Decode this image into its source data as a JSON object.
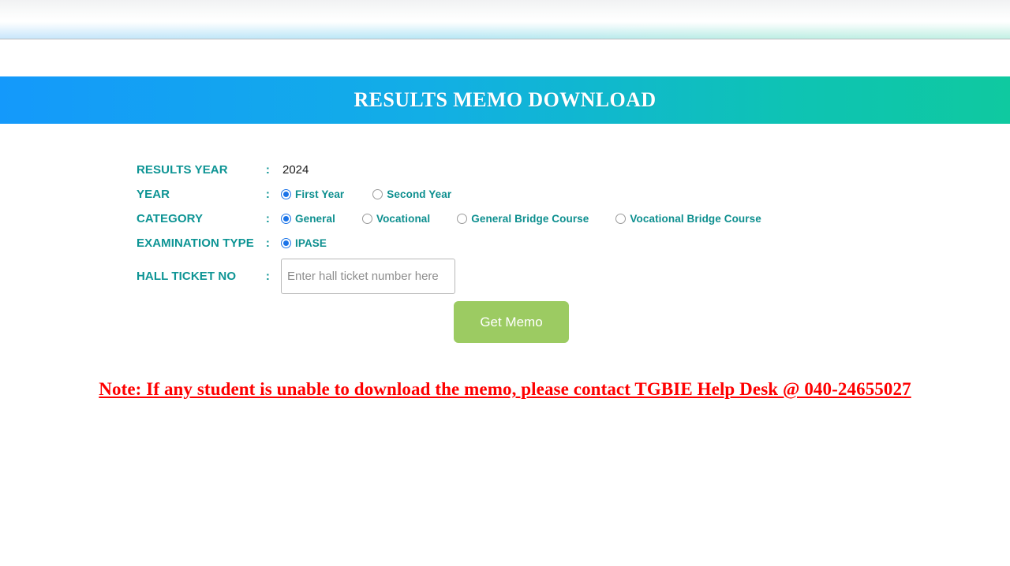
{
  "header": {
    "title": "RESULTS MEMO DOWNLOAD",
    "gradient_from": "#1499fb",
    "gradient_to": "#0fc9a0"
  },
  "form": {
    "results_year": {
      "label": "RESULTS YEAR",
      "colon": ":",
      "value": "2024"
    },
    "year": {
      "label": "YEAR",
      "colon": ":",
      "options": [
        {
          "label": "First Year",
          "selected": true
        },
        {
          "label": "Second Year",
          "selected": false
        }
      ]
    },
    "category": {
      "label": "CATEGORY",
      "colon": ":",
      "options": [
        {
          "label": "General",
          "selected": true
        },
        {
          "label": "Vocational",
          "selected": false
        },
        {
          "label": "General Bridge Course",
          "selected": false
        },
        {
          "label": "Vocational Bridge Course",
          "selected": false
        }
      ]
    },
    "examination_type": {
      "label": "EXAMINATION TYPE",
      "colon": ":",
      "options": [
        {
          "label": "IPASE",
          "selected": true
        }
      ]
    },
    "hall_ticket": {
      "label": "HALL TICKET NO",
      "colon": ":",
      "placeholder": "Enter hall ticket number here",
      "value": ""
    },
    "submit": {
      "label": "Get Memo",
      "color": "#9ccb62"
    }
  },
  "note": {
    "text": "Note: If any student is unable to download the memo, please contact TGBIE Help Desk @ 040-24655027",
    "color": "#fe0000"
  },
  "labels": {
    "accent_teal": "#0d9494",
    "radio_selected": "#1a73e8"
  }
}
